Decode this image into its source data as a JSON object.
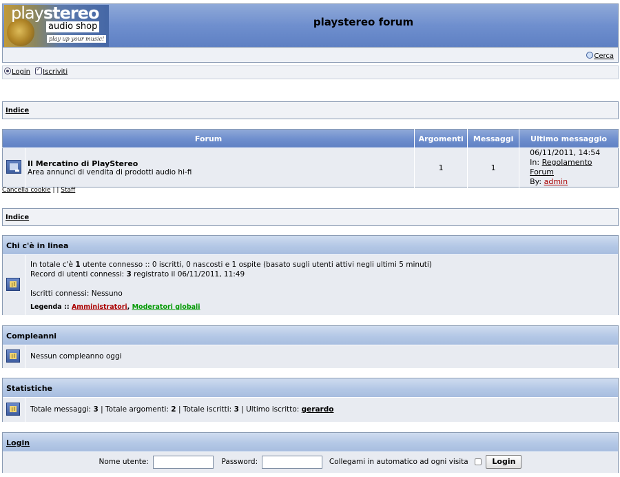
{
  "header": {
    "logo": {
      "brand_play": "play",
      "brand_stereo": "stereo",
      "sub": "audio shop",
      "tagline": "play up your music!"
    },
    "site_title": "playstereo forum",
    "search_label": "Cerca"
  },
  "userbar": {
    "login": "Login",
    "register": "Iscriviti"
  },
  "nav": {
    "index": "Indice"
  },
  "forum_table": {
    "headers": [
      "Forum",
      "Argomenti",
      "Messaggi",
      "Ultimo messaggio"
    ],
    "rows": [
      {
        "name": "Il Mercatino di PlayStereo",
        "description": "Area annunci di vendita di prodotti audio hi-fi",
        "topics": "1",
        "posts": "1",
        "last_date": "06/11/2011, 14:54",
        "last_in_prefix": "In:",
        "last_in_topic": "Regolamento Forum",
        "last_by_prefix": "By:",
        "last_by_user": "admin"
      }
    ]
  },
  "footer_links": {
    "delete_cookies": "Cancella cookie",
    "sep1": "|",
    "sep2": "|",
    "staff": "Staff"
  },
  "online": {
    "title": "Chi c'è in linea",
    "total_pre": "In totale c'è",
    "total_count": "1",
    "total_post": "utente connesso :: 0 iscritti, 0 nascosti e 1 ospite (basato sugli utenti attivi negli ultimi 5 minuti)",
    "record_pre": "Record di utenti connessi:",
    "record_count": "3",
    "record_post": "registrato il 06/11/2011, 11:49",
    "registered": "Iscritti connessi: Nessuno",
    "legend_label": "Legenda ::",
    "legend_admin": "Amministratori",
    "legend_comma": ",",
    "legend_mod": "Moderatori globali"
  },
  "birthdays": {
    "title": "Compleanni",
    "text": "Nessun compleanno oggi"
  },
  "stats": {
    "title": "Statistiche",
    "posts_label": "Totale messaggi:",
    "posts": "3",
    "topics_label": "| Totale argomenti:",
    "topics": "2",
    "members_label": "| Totale iscritti:",
    "members": "3",
    "newest_label": "| Ultimo iscritto:",
    "newest": "gerardo"
  },
  "login": {
    "title": "Login",
    "username_label": "Nome utente:",
    "password_label": "Password:",
    "autologin_label": "Collegami in automatico ad ogni visita",
    "button": "Login"
  },
  "colors": {
    "header_blue": "#6f8fce",
    "admin_red": "#aa0000",
    "mod_green": "#009900"
  }
}
